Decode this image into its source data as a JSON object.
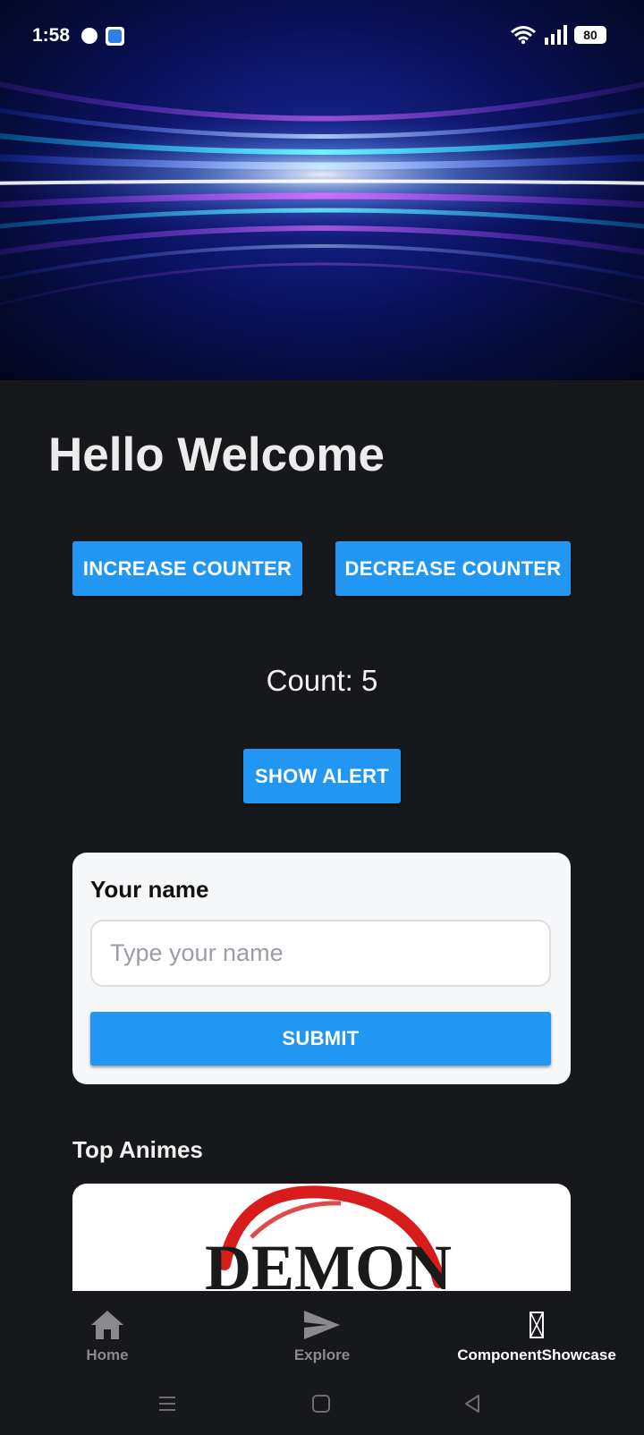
{
  "status_bar": {
    "time": "1:58",
    "battery": "80",
    "icons": [
      "messenger-icon",
      "app-icon",
      "wifi-icon",
      "signal-icon",
      "battery-icon"
    ]
  },
  "hero": {
    "image": "abstract-light-streaks-banner"
  },
  "page": {
    "title": "Hello Welcome",
    "increase_label": "INCREASE COUNTER",
    "decrease_label": "DECREASE COUNTER",
    "count_text": "Count: 5",
    "alert_label": "SHOW ALERT"
  },
  "form": {
    "label": "Your name",
    "placeholder": "Type your name",
    "value": "",
    "submit_label": "SUBMIT"
  },
  "section": {
    "title": "Top Animes",
    "card_image": "demon-slayer-logo",
    "card_image_text": "DEMON"
  },
  "tabs": [
    {
      "label": "Home",
      "icon": "home-icon",
      "active": false
    },
    {
      "label": "Explore",
      "icon": "send-icon",
      "active": false
    },
    {
      "label": "ComponentShowcase",
      "icon": "missing-glyph-icon",
      "active": true
    }
  ],
  "colors": {
    "accent": "#2196f3",
    "background": "#17181b",
    "card": "#f6f7f9",
    "inactive_tab": "#8a8a8e"
  },
  "system_nav": [
    "menu-icon",
    "home-square-icon",
    "back-icon"
  ]
}
